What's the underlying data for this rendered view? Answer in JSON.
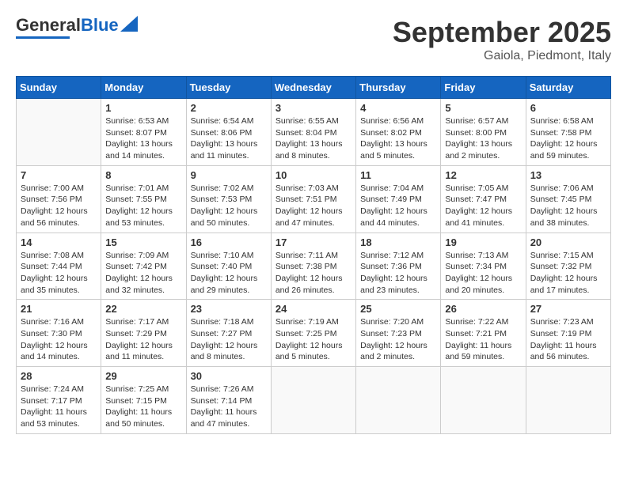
{
  "header": {
    "logo_general": "General",
    "logo_blue": "Blue",
    "month": "September 2025",
    "location": "Gaiola, Piedmont, Italy"
  },
  "weekdays": [
    "Sunday",
    "Monday",
    "Tuesday",
    "Wednesday",
    "Thursday",
    "Friday",
    "Saturday"
  ],
  "weeks": [
    [
      {
        "day": "",
        "info": ""
      },
      {
        "day": "1",
        "info": "Sunrise: 6:53 AM\nSunset: 8:07 PM\nDaylight: 13 hours\nand 14 minutes."
      },
      {
        "day": "2",
        "info": "Sunrise: 6:54 AM\nSunset: 8:06 PM\nDaylight: 13 hours\nand 11 minutes."
      },
      {
        "day": "3",
        "info": "Sunrise: 6:55 AM\nSunset: 8:04 PM\nDaylight: 13 hours\nand 8 minutes."
      },
      {
        "day": "4",
        "info": "Sunrise: 6:56 AM\nSunset: 8:02 PM\nDaylight: 13 hours\nand 5 minutes."
      },
      {
        "day": "5",
        "info": "Sunrise: 6:57 AM\nSunset: 8:00 PM\nDaylight: 13 hours\nand 2 minutes."
      },
      {
        "day": "6",
        "info": "Sunrise: 6:58 AM\nSunset: 7:58 PM\nDaylight: 12 hours\nand 59 minutes."
      }
    ],
    [
      {
        "day": "7",
        "info": "Sunrise: 7:00 AM\nSunset: 7:56 PM\nDaylight: 12 hours\nand 56 minutes."
      },
      {
        "day": "8",
        "info": "Sunrise: 7:01 AM\nSunset: 7:55 PM\nDaylight: 12 hours\nand 53 minutes."
      },
      {
        "day": "9",
        "info": "Sunrise: 7:02 AM\nSunset: 7:53 PM\nDaylight: 12 hours\nand 50 minutes."
      },
      {
        "day": "10",
        "info": "Sunrise: 7:03 AM\nSunset: 7:51 PM\nDaylight: 12 hours\nand 47 minutes."
      },
      {
        "day": "11",
        "info": "Sunrise: 7:04 AM\nSunset: 7:49 PM\nDaylight: 12 hours\nand 44 minutes."
      },
      {
        "day": "12",
        "info": "Sunrise: 7:05 AM\nSunset: 7:47 PM\nDaylight: 12 hours\nand 41 minutes."
      },
      {
        "day": "13",
        "info": "Sunrise: 7:06 AM\nSunset: 7:45 PM\nDaylight: 12 hours\nand 38 minutes."
      }
    ],
    [
      {
        "day": "14",
        "info": "Sunrise: 7:08 AM\nSunset: 7:44 PM\nDaylight: 12 hours\nand 35 minutes."
      },
      {
        "day": "15",
        "info": "Sunrise: 7:09 AM\nSunset: 7:42 PM\nDaylight: 12 hours\nand 32 minutes."
      },
      {
        "day": "16",
        "info": "Sunrise: 7:10 AM\nSunset: 7:40 PM\nDaylight: 12 hours\nand 29 minutes."
      },
      {
        "day": "17",
        "info": "Sunrise: 7:11 AM\nSunset: 7:38 PM\nDaylight: 12 hours\nand 26 minutes."
      },
      {
        "day": "18",
        "info": "Sunrise: 7:12 AM\nSunset: 7:36 PM\nDaylight: 12 hours\nand 23 minutes."
      },
      {
        "day": "19",
        "info": "Sunrise: 7:13 AM\nSunset: 7:34 PM\nDaylight: 12 hours\nand 20 minutes."
      },
      {
        "day": "20",
        "info": "Sunrise: 7:15 AM\nSunset: 7:32 PM\nDaylight: 12 hours\nand 17 minutes."
      }
    ],
    [
      {
        "day": "21",
        "info": "Sunrise: 7:16 AM\nSunset: 7:30 PM\nDaylight: 12 hours\nand 14 minutes."
      },
      {
        "day": "22",
        "info": "Sunrise: 7:17 AM\nSunset: 7:29 PM\nDaylight: 12 hours\nand 11 minutes."
      },
      {
        "day": "23",
        "info": "Sunrise: 7:18 AM\nSunset: 7:27 PM\nDaylight: 12 hours\nand 8 minutes."
      },
      {
        "day": "24",
        "info": "Sunrise: 7:19 AM\nSunset: 7:25 PM\nDaylight: 12 hours\nand 5 minutes."
      },
      {
        "day": "25",
        "info": "Sunrise: 7:20 AM\nSunset: 7:23 PM\nDaylight: 12 hours\nand 2 minutes."
      },
      {
        "day": "26",
        "info": "Sunrise: 7:22 AM\nSunset: 7:21 PM\nDaylight: 11 hours\nand 59 minutes."
      },
      {
        "day": "27",
        "info": "Sunrise: 7:23 AM\nSunset: 7:19 PM\nDaylight: 11 hours\nand 56 minutes."
      }
    ],
    [
      {
        "day": "28",
        "info": "Sunrise: 7:24 AM\nSunset: 7:17 PM\nDaylight: 11 hours\nand 53 minutes."
      },
      {
        "day": "29",
        "info": "Sunrise: 7:25 AM\nSunset: 7:15 PM\nDaylight: 11 hours\nand 50 minutes."
      },
      {
        "day": "30",
        "info": "Sunrise: 7:26 AM\nSunset: 7:14 PM\nDaylight: 11 hours\nand 47 minutes."
      },
      {
        "day": "",
        "info": ""
      },
      {
        "day": "",
        "info": ""
      },
      {
        "day": "",
        "info": ""
      },
      {
        "day": "",
        "info": ""
      }
    ]
  ]
}
